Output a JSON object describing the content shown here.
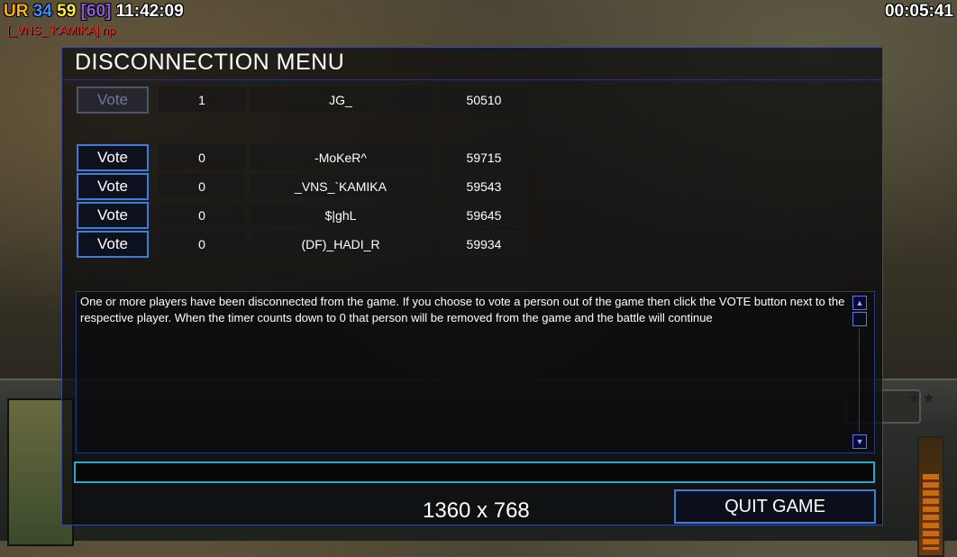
{
  "overlay": {
    "ur_label": "UR",
    "fps_a": "34",
    "fps_b": "59",
    "fps_c": "[60]",
    "clock": "11:42:09",
    "timer": "00:05:41",
    "player_tag": "[_VNS_`KAMIKA] np"
  },
  "menu": {
    "title": "DISCONNECTION MENU",
    "players": [
      {
        "vote_label": "Vote",
        "count": "1",
        "name": "JG_",
        "ping": "50510",
        "enabled": false
      },
      {
        "vote_label": "Vote",
        "count": "0",
        "name": "-MoKeR^",
        "ping": "59715",
        "enabled": true
      },
      {
        "vote_label": "Vote",
        "count": "0",
        "name": "_VNS_`KAMIKA",
        "ping": "59543",
        "enabled": true
      },
      {
        "vote_label": "Vote",
        "count": "0",
        "name": "$|ghL",
        "ping": "59645",
        "enabled": true
      },
      {
        "vote_label": "Vote",
        "count": "0",
        "name": "(DF)_HADI_R",
        "ping": "59934",
        "enabled": true
      }
    ],
    "message": "One or more players have been disconnected from the game. If you choose to vote a person out of the game then click the VOTE button next to the respective player. When the timer counts down to 0 that person will be removed from the game and the battle will continue",
    "resolution": "1360 x 768",
    "quit_label": "QUIT GAME"
  },
  "icons": {
    "scroll_up": "arrow-up-icon",
    "scroll_down": "arrow-down-icon"
  },
  "colors": {
    "button_border": "#3f7cd8",
    "chat_border": "#2aa8c8",
    "panel_border": "#3a4a8a"
  }
}
